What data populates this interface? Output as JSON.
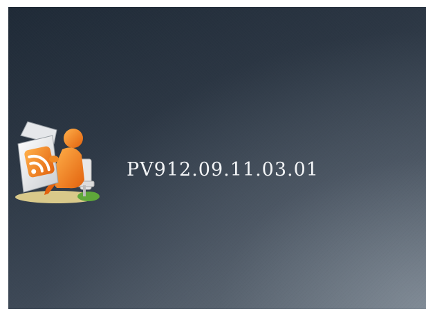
{
  "splash": {
    "version_text": "PV912.09.11.03.01",
    "logo_icon": "rss-reader-person-icon",
    "background_colors": [
      "#1f2a37",
      "#3d4856",
      "#5b6672"
    ],
    "accent_color": "#f07a1a",
    "text_color": "#f2f4f6"
  }
}
